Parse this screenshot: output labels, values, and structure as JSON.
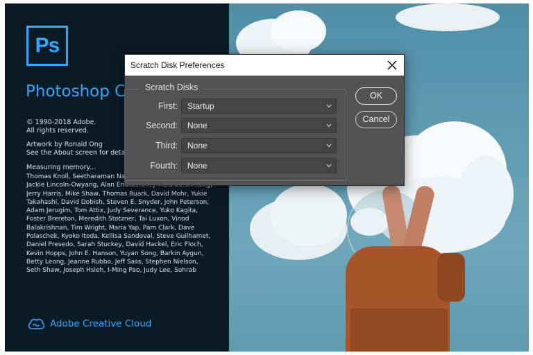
{
  "splash": {
    "logo_text": "Ps",
    "app_name": "Photoshop CC",
    "copyright": "© 1990-2018 Adobe.",
    "rights": "All rights reserved.",
    "artwork_by": "Artwork by Ronald Ong",
    "about_note": "See the About screen for details",
    "status": "Measuring memory...",
    "credits": "Thomas Knoll, Seetharaman Narayanan, Russell Williams, Jackie Lincoln-Owyang, Alan Erickson, Ivy Mak, Sarah Kong, Jerry Harris, Mike Shaw, Thomas Ruark, David Mohr, Yukie Takahashi, David Dobish, Steven E. Snyder, John Peterson, Adam Jerugim, Tom Attix, Judy Severance, Yuko Kagita, Foster Brereton, Meredith Stotzner, Tai Luxon, Vinod Balakrishnan, Tim Wright, Maria Yap, Pam Clark, Dave Polaschek, Kyoko Itoda, Kellisa Sandoval, Steve Guilhamet, Daniel Presedo, Sarah Stuckey, David Hackel, Eric Floch, Kevin Hopps, John E. Hanson, Yuyan Song, Barkin Aygun, Betty Leong, Jeanne Rubbo, Jeff Sass, Stephen Nielson, Seth Shaw, Joseph Hsieh, I-Ming Pao, Judy Lee, Sohrab",
    "cc_label": "Adobe Creative Cloud",
    "brand_color": "#31a8ff"
  },
  "dialog": {
    "title": "Scratch Disk Preferences",
    "group_label": "Scratch Disks",
    "rows": [
      {
        "label": "First:",
        "value": "Startup"
      },
      {
        "label": "Second:",
        "value": "None"
      },
      {
        "label": "Third:",
        "value": "None"
      },
      {
        "label": "Fourth:",
        "value": "None"
      }
    ],
    "ok_label": "OK",
    "cancel_label": "Cancel",
    "close_icon": "close-icon",
    "dropdown_icon": "chevron-down-icon"
  }
}
